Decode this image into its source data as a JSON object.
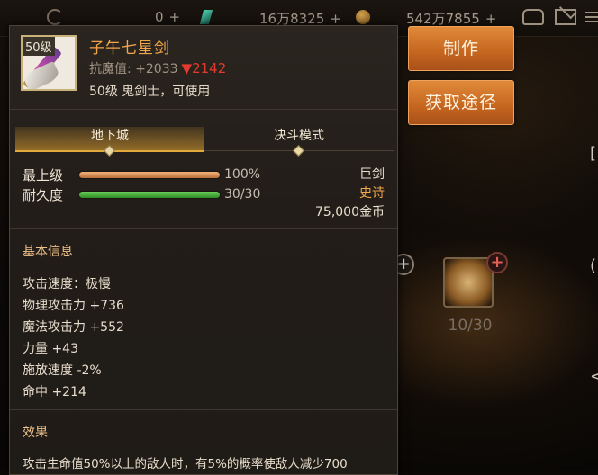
{
  "topbar": {
    "currency1": "0",
    "currency2": "16万8325",
    "currency3": "542万7855",
    "plus": "+"
  },
  "buttons": {
    "craft": "制作",
    "obtain": "获取途径"
  },
  "material": {
    "count": "10/30"
  },
  "item": {
    "level_badge": "50级",
    "name": "子午七星剑",
    "stat_label": "抗魔值:",
    "stat_value": "+2033",
    "stat_delta": "▼2142",
    "requirement": "50级 鬼剑士，可使用",
    "type": "巨剑",
    "grade": "史诗",
    "price": "75,000金币",
    "name_color": "#f2a54b",
    "grade_color": "#f2a54b",
    "delta_color": "#e33b2f"
  },
  "tabs": [
    {
      "label": "地下城",
      "active": true
    },
    {
      "label": "决斗模式",
      "active": false
    }
  ],
  "bars": {
    "level": {
      "label": "最上级",
      "value": "100%",
      "fraction": 1.0
    },
    "durability": {
      "label": "耐久度",
      "value": "30/30",
      "fraction": 1.0
    }
  },
  "basic_info": {
    "title": "基本信息",
    "attributes": [
      "攻击速度：极慢",
      "物理攻击力 +736",
      "魔法攻击力 +552",
      "力量 +43",
      "施放速度 -2%",
      "命中 +214"
    ]
  },
  "effect": {
    "title": "效果",
    "text": "攻击生命值50%以上的敌人时，有5%的概率使敌人减少700"
  }
}
